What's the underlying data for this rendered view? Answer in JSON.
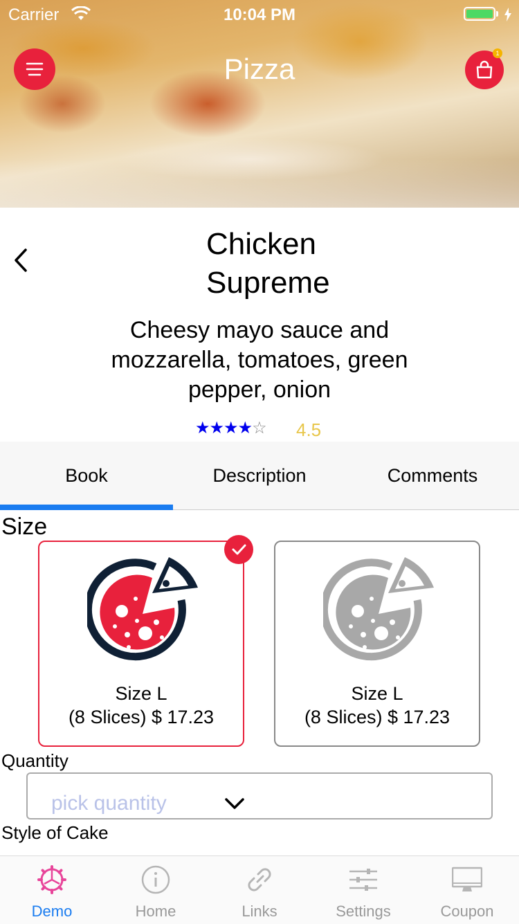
{
  "status_bar": {
    "carrier": "Carrier",
    "time": "10:04 PM"
  },
  "header": {
    "title": "Pizza",
    "cart_badge": "1"
  },
  "product": {
    "name": "Chicken Supreme",
    "description": "Cheesy mayo sauce and mozzarella, tomatoes, green pepper, onion",
    "rating_stars": 4,
    "rating_max": 5,
    "rating": "4.5"
  },
  "tabs": [
    {
      "label": "Book",
      "active": true
    },
    {
      "label": "Description",
      "active": false
    },
    {
      "label": "Comments",
      "active": false
    }
  ],
  "size_section": {
    "label": "Size",
    "options": [
      {
        "line1": "Size L",
        "line2": "(8 Slices)  $ 17.23",
        "selected": true
      },
      {
        "line1": "Size L",
        "line2": "(8 Slices)  $ 17.23",
        "selected": false
      }
    ]
  },
  "quantity": {
    "label": "Quantity",
    "placeholder": "pick quantity"
  },
  "style_section": {
    "label": "Style of Cake"
  },
  "bottom_nav": [
    {
      "label": "Demo",
      "icon": "gear-icon",
      "active": true
    },
    {
      "label": "Home",
      "icon": "info-icon",
      "active": false
    },
    {
      "label": "Links",
      "icon": "link-icon",
      "active": false
    },
    {
      "label": "Settings",
      "icon": "sliders-icon",
      "active": false
    },
    {
      "label": "Coupon",
      "icon": "monitor-icon",
      "active": false
    }
  ],
  "colors": {
    "accent": "#e8213c",
    "tab_indicator": "#1a7cf0",
    "rating": "#e8c64a",
    "pizza_dark": "#0f2035"
  }
}
